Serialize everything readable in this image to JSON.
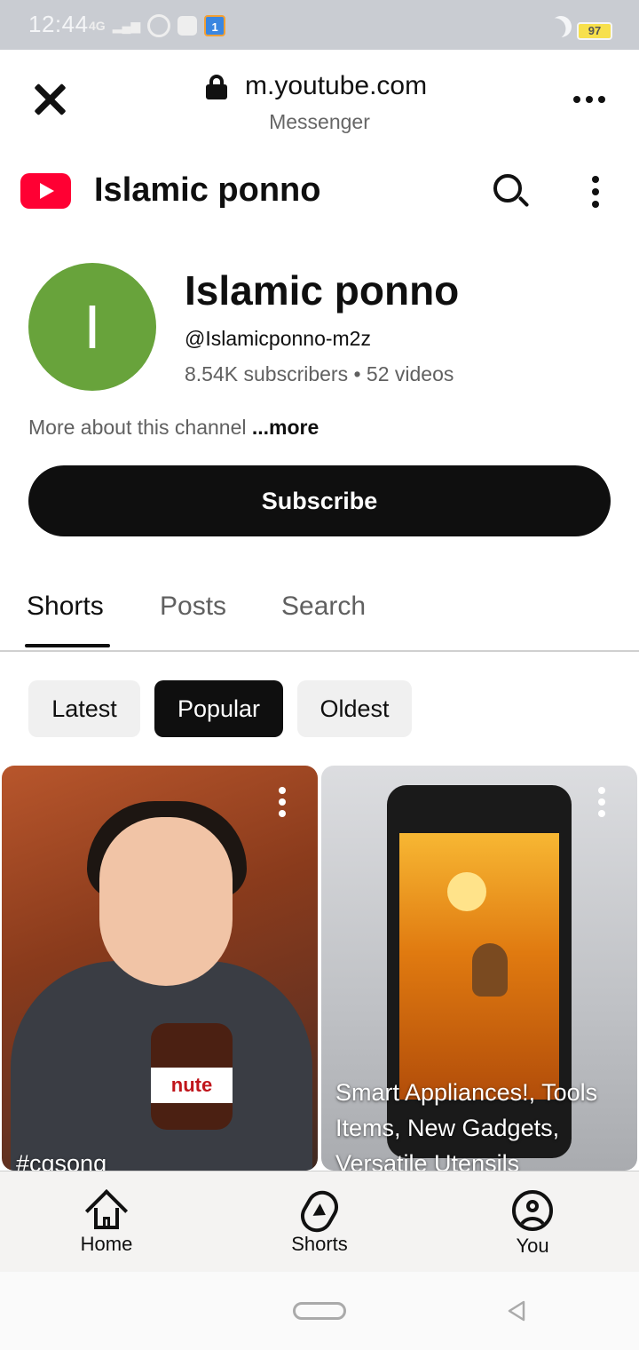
{
  "status_bar": {
    "time": "12:44",
    "network": "4G",
    "vpn": "VPN",
    "app_badge": "1",
    "battery": "97"
  },
  "browser": {
    "url": "m.youtube.com",
    "source_app": "Messenger"
  },
  "header": {
    "title": "Islamic ponno"
  },
  "channel": {
    "avatar_letter": "I",
    "name": "Islamic ponno",
    "handle": "@Islamicponno-m2z",
    "stats": "8.54K subscribers • 52 videos",
    "about": "More about this channel",
    "about_more": "...more",
    "subscribe_label": "Subscribe"
  },
  "tabs": [
    {
      "label": "Shorts",
      "active": true
    },
    {
      "label": "Posts",
      "active": false
    },
    {
      "label": "Search",
      "active": false
    }
  ],
  "chips": [
    {
      "label": "Latest",
      "selected": false
    },
    {
      "label": "Popular",
      "selected": true
    },
    {
      "label": "Oldest",
      "selected": false
    }
  ],
  "cards": [
    {
      "title": "#cgsong",
      "product_label": "nute"
    },
    {
      "title": "Smart Appliances!, Tools Items, New Gadgets, Versatile Utensils"
    }
  ],
  "bottom_nav": [
    {
      "label": "Home",
      "icon": "home-icon"
    },
    {
      "label": "Shorts",
      "icon": "shorts-icon"
    },
    {
      "label": "You",
      "icon": "you-icon"
    }
  ],
  "colors": {
    "youtube_red": "#ff0033",
    "avatar_green": "#68a33b",
    "subscribe_bg": "#0f0f0f"
  }
}
